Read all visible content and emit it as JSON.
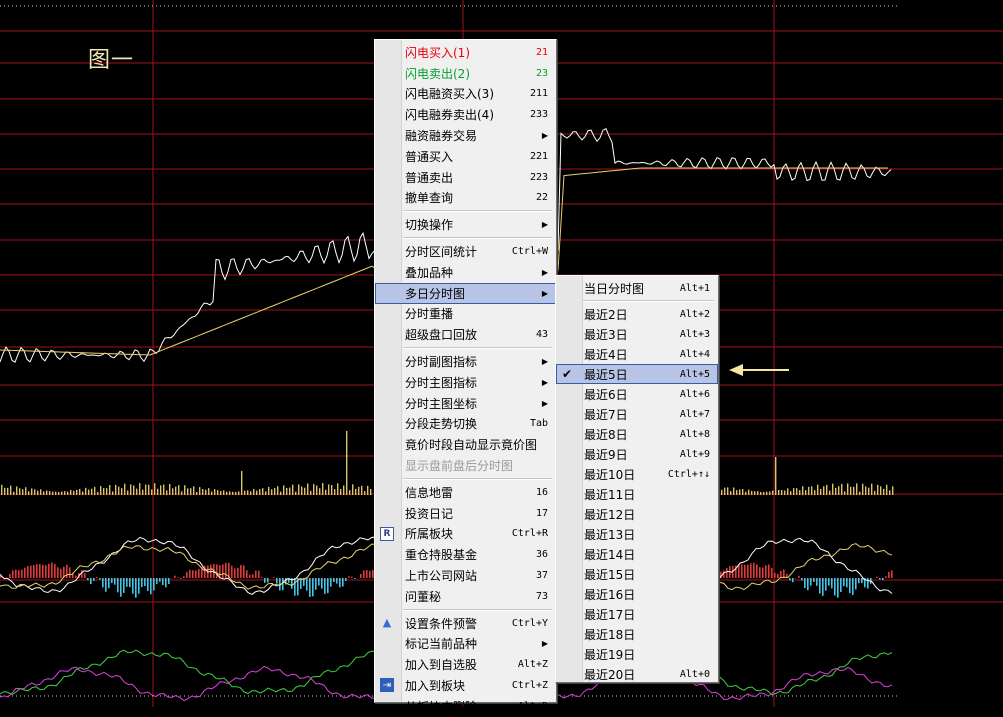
{
  "caption": "图一",
  "main_menu": [
    {
      "label": "闪电买入(1)",
      "shortcut": "21",
      "style": "red"
    },
    {
      "label": "闪电卖出(2)",
      "shortcut": "23",
      "style": "green"
    },
    {
      "label": "闪电融资买入(3)",
      "shortcut": "211"
    },
    {
      "label": "闪电融券卖出(4)",
      "shortcut": "233"
    },
    {
      "label": "融资融券交易",
      "submenu": true
    },
    {
      "label": "普通买入",
      "shortcut": "221"
    },
    {
      "label": "普通卖出",
      "shortcut": "223"
    },
    {
      "label": "撤单查询",
      "shortcut": "22"
    },
    {
      "separator": true
    },
    {
      "label": "切换操作",
      "submenu": true
    },
    {
      "separator": true
    },
    {
      "label": "分时区间统计",
      "shortcut": "Ctrl+W"
    },
    {
      "label": "叠加品种",
      "submenu": true
    },
    {
      "label": "多日分时图",
      "submenu": true,
      "highlighted": true
    },
    {
      "label": "分时重播"
    },
    {
      "label": "超级盘口回放",
      "shortcut": "43"
    },
    {
      "separator": true
    },
    {
      "label": "分时副图指标",
      "submenu": true
    },
    {
      "label": "分时主图指标",
      "submenu": true
    },
    {
      "label": "分时主图坐标",
      "submenu": true
    },
    {
      "label": "分段走势切换",
      "shortcut": "Tab"
    },
    {
      "label": "竟价时段自动显示竟价图"
    },
    {
      "label": "显示盘前盘后分时图",
      "style": "disabled"
    },
    {
      "separator": true
    },
    {
      "label": "信息地雷",
      "shortcut": "16"
    },
    {
      "label": "投资日记",
      "shortcut": "17"
    },
    {
      "label": "所属板块",
      "shortcut": "Ctrl+R",
      "icon": "R"
    },
    {
      "label": "重仓持股基金",
      "shortcut": "36"
    },
    {
      "label": "上市公司网站",
      "shortcut": "37"
    },
    {
      "label": "问董秘",
      "shortcut": "73"
    },
    {
      "separator": true
    },
    {
      "label": "设置条件预警",
      "shortcut": "Ctrl+Y",
      "icon": "▲"
    },
    {
      "label": "标记当前品种",
      "submenu": true
    },
    {
      "label": "加入到自选股",
      "shortcut": "Alt+Z"
    },
    {
      "label": "加入到板块",
      "shortcut": "Ctrl+Z",
      "icon": "⇥"
    },
    {
      "label": "从板块中删除",
      "shortcut": "Alt+D"
    }
  ],
  "sub_menu": [
    {
      "label": "当日分时图",
      "shortcut": "Alt+1"
    },
    {
      "separator": true
    },
    {
      "label": "最近2日",
      "shortcut": "Alt+2"
    },
    {
      "label": "最近3日",
      "shortcut": "Alt+3"
    },
    {
      "label": "最近4日",
      "shortcut": "Alt+4"
    },
    {
      "label": "最近5日",
      "shortcut": "Alt+5",
      "checked": true,
      "highlighted": true
    },
    {
      "label": "最近6日",
      "shortcut": "Alt+6"
    },
    {
      "label": "最近7日",
      "shortcut": "Alt+7"
    },
    {
      "label": "最近8日",
      "shortcut": "Alt+8"
    },
    {
      "label": "最近9日",
      "shortcut": "Alt+9"
    },
    {
      "label": "最近10日",
      "shortcut": "Ctrl+↑↓"
    },
    {
      "label": "最近11日"
    },
    {
      "label": "最近12日"
    },
    {
      "label": "最近13日"
    },
    {
      "label": "最近14日"
    },
    {
      "label": "最近15日"
    },
    {
      "label": "最近16日"
    },
    {
      "label": "最近17日"
    },
    {
      "label": "最近18日"
    },
    {
      "label": "最近19日"
    },
    {
      "label": "最近20日",
      "shortcut": "Alt+0"
    }
  ],
  "colors": {
    "price_line": "#ffffff",
    "avg_line": "#e8d26e",
    "grid_red": "#a0141c",
    "volume_bar": "#d9c56a",
    "macd_positive": "#e03a3a",
    "macd_negative": "#40c8e8",
    "pointer_arrow": "#f2e8a0"
  }
}
